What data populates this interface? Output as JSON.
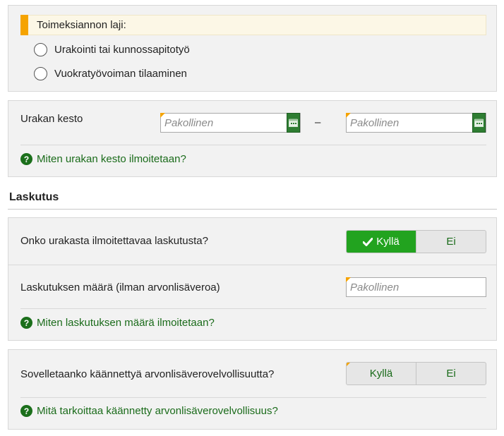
{
  "type_panel": {
    "heading": "Toimeksiannon laji:",
    "options": [
      "Urakointi tai kunnossapitotyö",
      "Vuokratyövoiman tilaaminen"
    ]
  },
  "duration_panel": {
    "label": "Urakan kesto",
    "start_placeholder": "Pakollinen",
    "end_placeholder": "Pakollinen",
    "separator": "–",
    "help": "Miten urakan kesto ilmoitetaan?"
  },
  "billing_section": {
    "heading": "Laskutus",
    "question": "Onko urakasta ilmoitettavaa laskutusta?",
    "yes_label": "Kyllä",
    "no_label": "Ei",
    "selected": "yes",
    "amount_label": "Laskutuksen määrä (ilman arvonlisäveroa)",
    "amount_placeholder": "Pakollinen",
    "help": "Miten laskutuksen määrä ilmoitetaan?"
  },
  "reverse_vat_panel": {
    "question": "Sovelletaanko käännettyä arvonlisäverovelvollisuutta?",
    "yes_label": "Kyllä",
    "no_label": "Ei",
    "help": "Mitä tarkoittaa käännetty arvonlisäverovelvollisuus?"
  },
  "colors": {
    "accent_green": "#22a31f",
    "help_green": "#1a6b1a",
    "required_orange": "#f5a300",
    "panel_bg": "#f2f2f2"
  },
  "icons": {
    "calendar": "calendar-icon",
    "help": "help-icon",
    "check": "check-icon"
  }
}
